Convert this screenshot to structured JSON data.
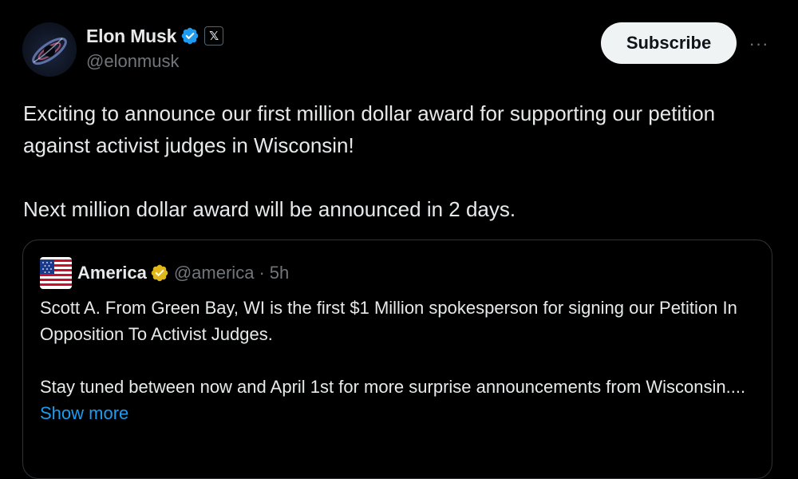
{
  "author": {
    "display_name": "Elon Musk",
    "handle": "@elonmusk",
    "verified_badge_color": "#1d9bf0",
    "affiliate_badge": "𝕏"
  },
  "actions": {
    "subscribe_label": "Subscribe",
    "more_label": "···"
  },
  "tweet": {
    "paragraphs": [
      "Exciting to announce our first million dollar award for supporting our petition against activist judges in Wisconsin!",
      "Next million dollar award will be announced in 2 days."
    ]
  },
  "quote": {
    "display_name": "America",
    "handle": "@america",
    "separator": "·",
    "time": "5h",
    "verified_badge_color": "#e2b719",
    "paragraphs": [
      "Scott A. From Green Bay, WI is the first $1 Million spokesperson for signing our Petition In Opposition To Activist Judges.",
      "Stay tuned between now and April 1st for more surprise announcements from Wisconsin...."
    ],
    "show_more_label": "Show more"
  },
  "colors": {
    "background": "#000000",
    "text_primary": "#e7e9ea",
    "text_secondary": "#71767b",
    "link": "#1d9bf0",
    "border": "#2f3336"
  }
}
